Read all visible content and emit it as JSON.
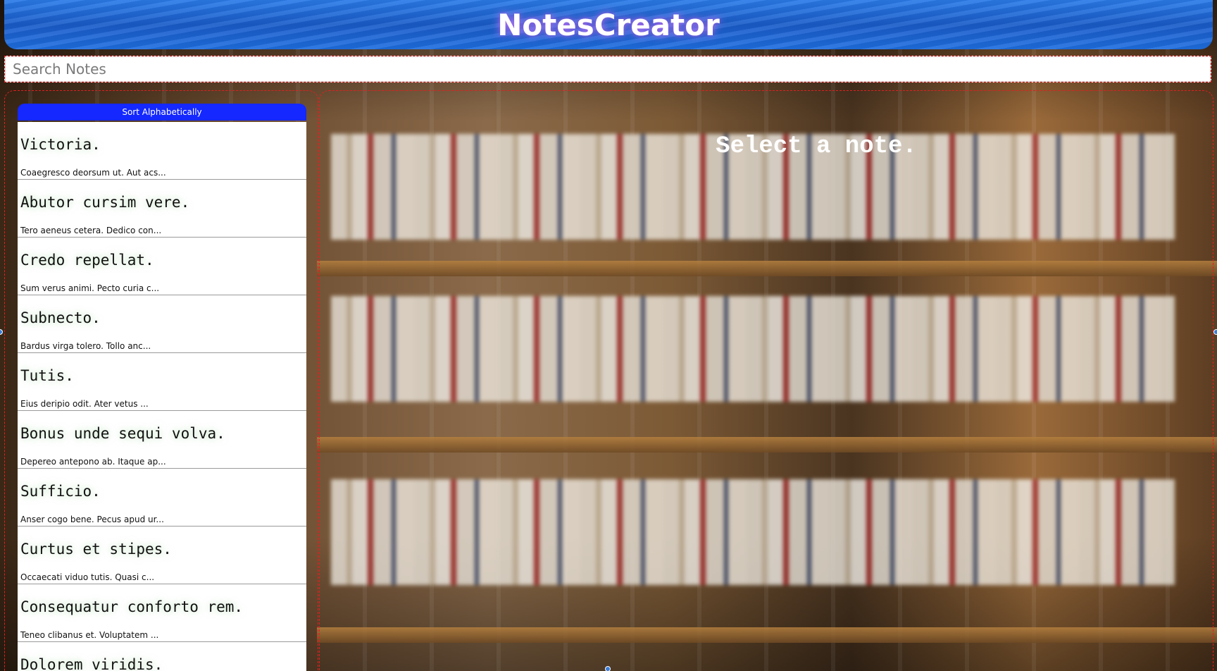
{
  "header": {
    "title": "NotesCreator"
  },
  "search": {
    "placeholder": "Search Notes",
    "value": ""
  },
  "sidebar": {
    "sort_label": "Sort Alphabetically",
    "notes": [
      {
        "title": "Victoria.",
        "preview": "Coaegresco deorsum ut. Aut acs..."
      },
      {
        "title": "Abutor cursim vere.",
        "preview": "Tero aeneus cetera.  Dedico con..."
      },
      {
        "title": "Credo repellat.",
        "preview": "Sum verus animi.  Pecto curia c..."
      },
      {
        "title": "Subnecto.",
        "preview": "Bardus virga tolero. Tollo anc..."
      },
      {
        "title": "Tutis.",
        "preview": "Eius deripio odit. Ater vetus ..."
      },
      {
        "title": "Bonus unde sequi volva.",
        "preview": "Depereo antepono ab.  Itaque ap..."
      },
      {
        "title": "Sufficio.",
        "preview": "Anser cogo bene.  Pecus apud ur..."
      },
      {
        "title": "Curtus et stipes.",
        "preview": "Occaecati viduo tutis. Quasi c..."
      },
      {
        "title": "Consequatur conforto rem.",
        "preview": "Teneo clibanus et. Voluptatem ..."
      },
      {
        "title": "Dolorem viridis.",
        "preview": ""
      }
    ]
  },
  "main": {
    "empty_message": "Select a note."
  },
  "colors": {
    "header_blue": "#1f6ee0",
    "sort_button": "#1428ff",
    "outline": "#e02020"
  }
}
